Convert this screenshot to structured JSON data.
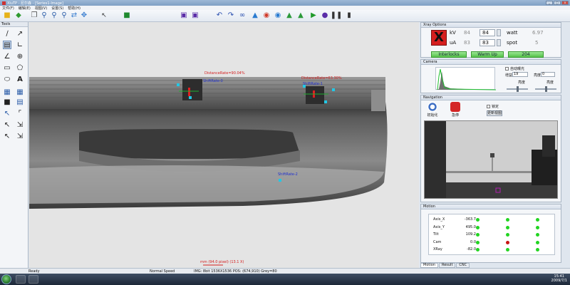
{
  "app": {
    "title": "XiuTP - 尼尔森 - [Series1-Image]"
  },
  "menu": [
    "文件(F)",
    "编辑(E)",
    "视图(V)",
    "设置(S)",
    "帮助(H)"
  ],
  "tools": {
    "title": "Tools"
  },
  "measurements": {
    "distance_left": "DistanceRate=90.04%",
    "distance_right": "DistanceRate=63.30%",
    "shift_left": "ShiftRate-0",
    "shift_right": "ShiftRate-1",
    "shift_bottom": "ShiftRate-2",
    "bottom_note": "mm (94.0 pixel) (13.1 X)"
  },
  "xray": {
    "title": "Xray Options",
    "kv_label": "kV",
    "kv_set": "84",
    "kv_actual": "84",
    "ua_label": "uA",
    "ua_set": "83",
    "ua_actual": "83",
    "watt_label": "watt",
    "watt_value": "6.97",
    "spot_label": "spot",
    "spot_value": "5",
    "interlocks": "Interlocks",
    "warmup": "Warm Up",
    "status_code": "204",
    "accent": "#d51f1f"
  },
  "camera": {
    "title": "Camera",
    "auto_exposure": "自动曝光",
    "gain_label": "增益",
    "gain_value": "19",
    "brightness_label": "亮度",
    "brightness_value": "0",
    "contrast_label": "亮度",
    "sharp_label": "亮度"
  },
  "navigation": {
    "title": "Navigation",
    "home_label": "初始化",
    "stop_label": "急停",
    "checkbox_label": "锁定",
    "update_button": "更新视图"
  },
  "motion": {
    "title": "Motion",
    "axes": [
      {
        "name": "Axis_X",
        "value": "-363.7",
        "dots": [
          "green",
          "green",
          "green"
        ]
      },
      {
        "name": "Axis_Y",
        "value": "495.0",
        "dots": [
          "green",
          "green",
          "green"
        ]
      },
      {
        "name": "Tilt",
        "value": "109.2",
        "dots": [
          "green",
          "green",
          "green"
        ]
      },
      {
        "name": "Cam",
        "value": "0.0",
        "dots": [
          "green",
          "red",
          "green"
        ]
      },
      {
        "name": "XRay",
        "value": "-82.0",
        "dots": [
          "green",
          "green",
          "green"
        ]
      }
    ],
    "colors": {
      "green": "#22d422",
      "red": "#c81414"
    }
  },
  "tabs": [
    "Motion",
    "Result",
    "CNC"
  ],
  "status": {
    "ready": "Ready",
    "speed": "Normal Speed",
    "image_info": "IMG: 8bit 1536X1536   POS: (674,910) Grey=80"
  },
  "taskbar": {
    "time": "15:41",
    "date": "2009/7/1"
  }
}
